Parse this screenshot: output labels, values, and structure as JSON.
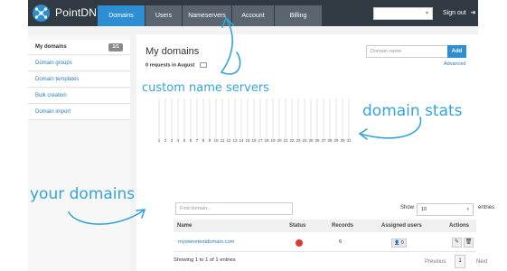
{
  "app": {
    "brand": "PointDNS"
  },
  "nav": {
    "tabs": [
      {
        "label": "Domains",
        "active": true
      },
      {
        "label": "Users"
      },
      {
        "label": "Nameservers"
      },
      {
        "label": "Account"
      },
      {
        "label": "Billing"
      }
    ],
    "select_value": "",
    "signout": "Sign out",
    "signout_icon": "signout-arrow-icon"
  },
  "sidebar": {
    "items": [
      {
        "label": "My domains",
        "badge": "1/1",
        "active": true
      },
      {
        "label": "Domain groups"
      },
      {
        "label": "Domain templates"
      },
      {
        "label": "Bulk creation"
      },
      {
        "label": "Domain import"
      }
    ]
  },
  "main": {
    "title": "My domains",
    "requests": "0 requests in August",
    "domain_input_placeholder": "Domain name",
    "add_label": "Add",
    "advanced_label": "Advanced",
    "find_placeholder": "Find domain...",
    "show_label": "Show",
    "show_value": "10",
    "entries_label": "entries",
    "columns": [
      "Name",
      "Status",
      "Records",
      "Assigned users",
      "Actions"
    ],
    "rows": [
      {
        "name": "myownetestdomain.com",
        "status_color": "#e03a2f",
        "records": "6",
        "assigned_users": "0"
      }
    ],
    "showing_text": "Showing 1 to 1 of 1 entries",
    "pagination": {
      "previous": "Previous",
      "page": "1",
      "next": "Next"
    }
  },
  "chart_data": {
    "type": "bar",
    "categories": [
      "1",
      "2",
      "3",
      "4",
      "5",
      "6",
      "7",
      "8",
      "9",
      "10",
      "11",
      "12",
      "13",
      "14",
      "15",
      "16",
      "17",
      "18",
      "19",
      "20",
      "21",
      "22",
      "23",
      "24",
      "25",
      "26",
      "27",
      "28",
      "29",
      "30",
      "31"
    ],
    "values": [
      0,
      0,
      0,
      0,
      0,
      0,
      0,
      0,
      0,
      0,
      0,
      0,
      0,
      0,
      0,
      0,
      0,
      0,
      0,
      0,
      0,
      0,
      0,
      0,
      0,
      0,
      0,
      0,
      0,
      0,
      0
    ],
    "grid": true
  },
  "annotations": {
    "custom_nameservers": "custom name servers",
    "domain_stats": "domain stats",
    "your_domains": "your domains"
  },
  "colors": {
    "accent": "#2d8ed3",
    "topbar": "#323b44",
    "annotation": "#34a4d6",
    "status_error": "#e03a2f"
  }
}
